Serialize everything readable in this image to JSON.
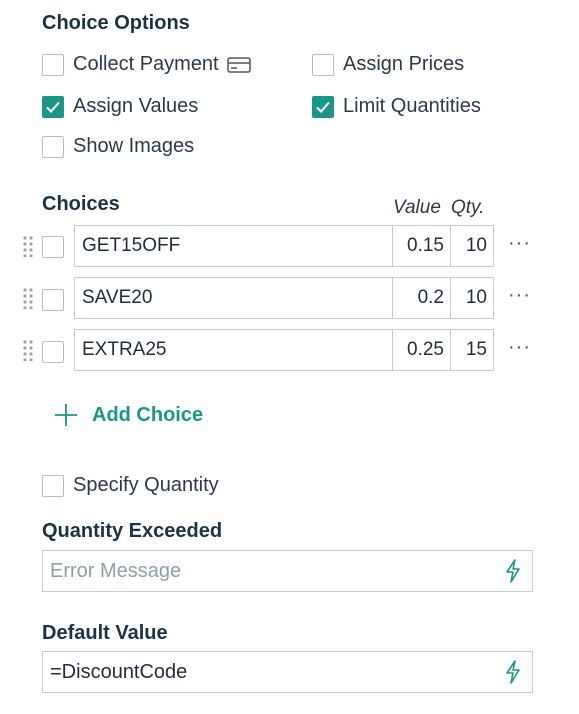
{
  "choice_options": {
    "title": "Choice Options",
    "collect_payment": {
      "label": "Collect Payment",
      "checked": false
    },
    "assign_prices": {
      "label": "Assign Prices",
      "checked": false
    },
    "assign_values": {
      "label": "Assign Values",
      "checked": true
    },
    "limit_quantities": {
      "label": "Limit Quantities",
      "checked": true
    },
    "show_images": {
      "label": "Show Images",
      "checked": false
    }
  },
  "choices": {
    "title": "Choices",
    "value_header": "Value",
    "qty_header": "Qty.",
    "rows": [
      {
        "name": "GET15OFF",
        "value": "0.15",
        "qty": "10"
      },
      {
        "name": "SAVE20",
        "value": "0.2",
        "qty": "10"
      },
      {
        "name": "EXTRA25",
        "value": "0.25",
        "qty": "15"
      }
    ],
    "add_label": "Add Choice",
    "more_label": "···"
  },
  "specify_quantity": {
    "label": "Specify Quantity",
    "checked": false
  },
  "quantity_exceeded": {
    "title": "Quantity Exceeded",
    "placeholder": "Error Message",
    "value": ""
  },
  "default_value": {
    "title": "Default Value",
    "value": "=DiscountCode"
  },
  "colors": {
    "accent": "#1c9688",
    "text": "#1b3445",
    "border": "#c5ccd3"
  }
}
